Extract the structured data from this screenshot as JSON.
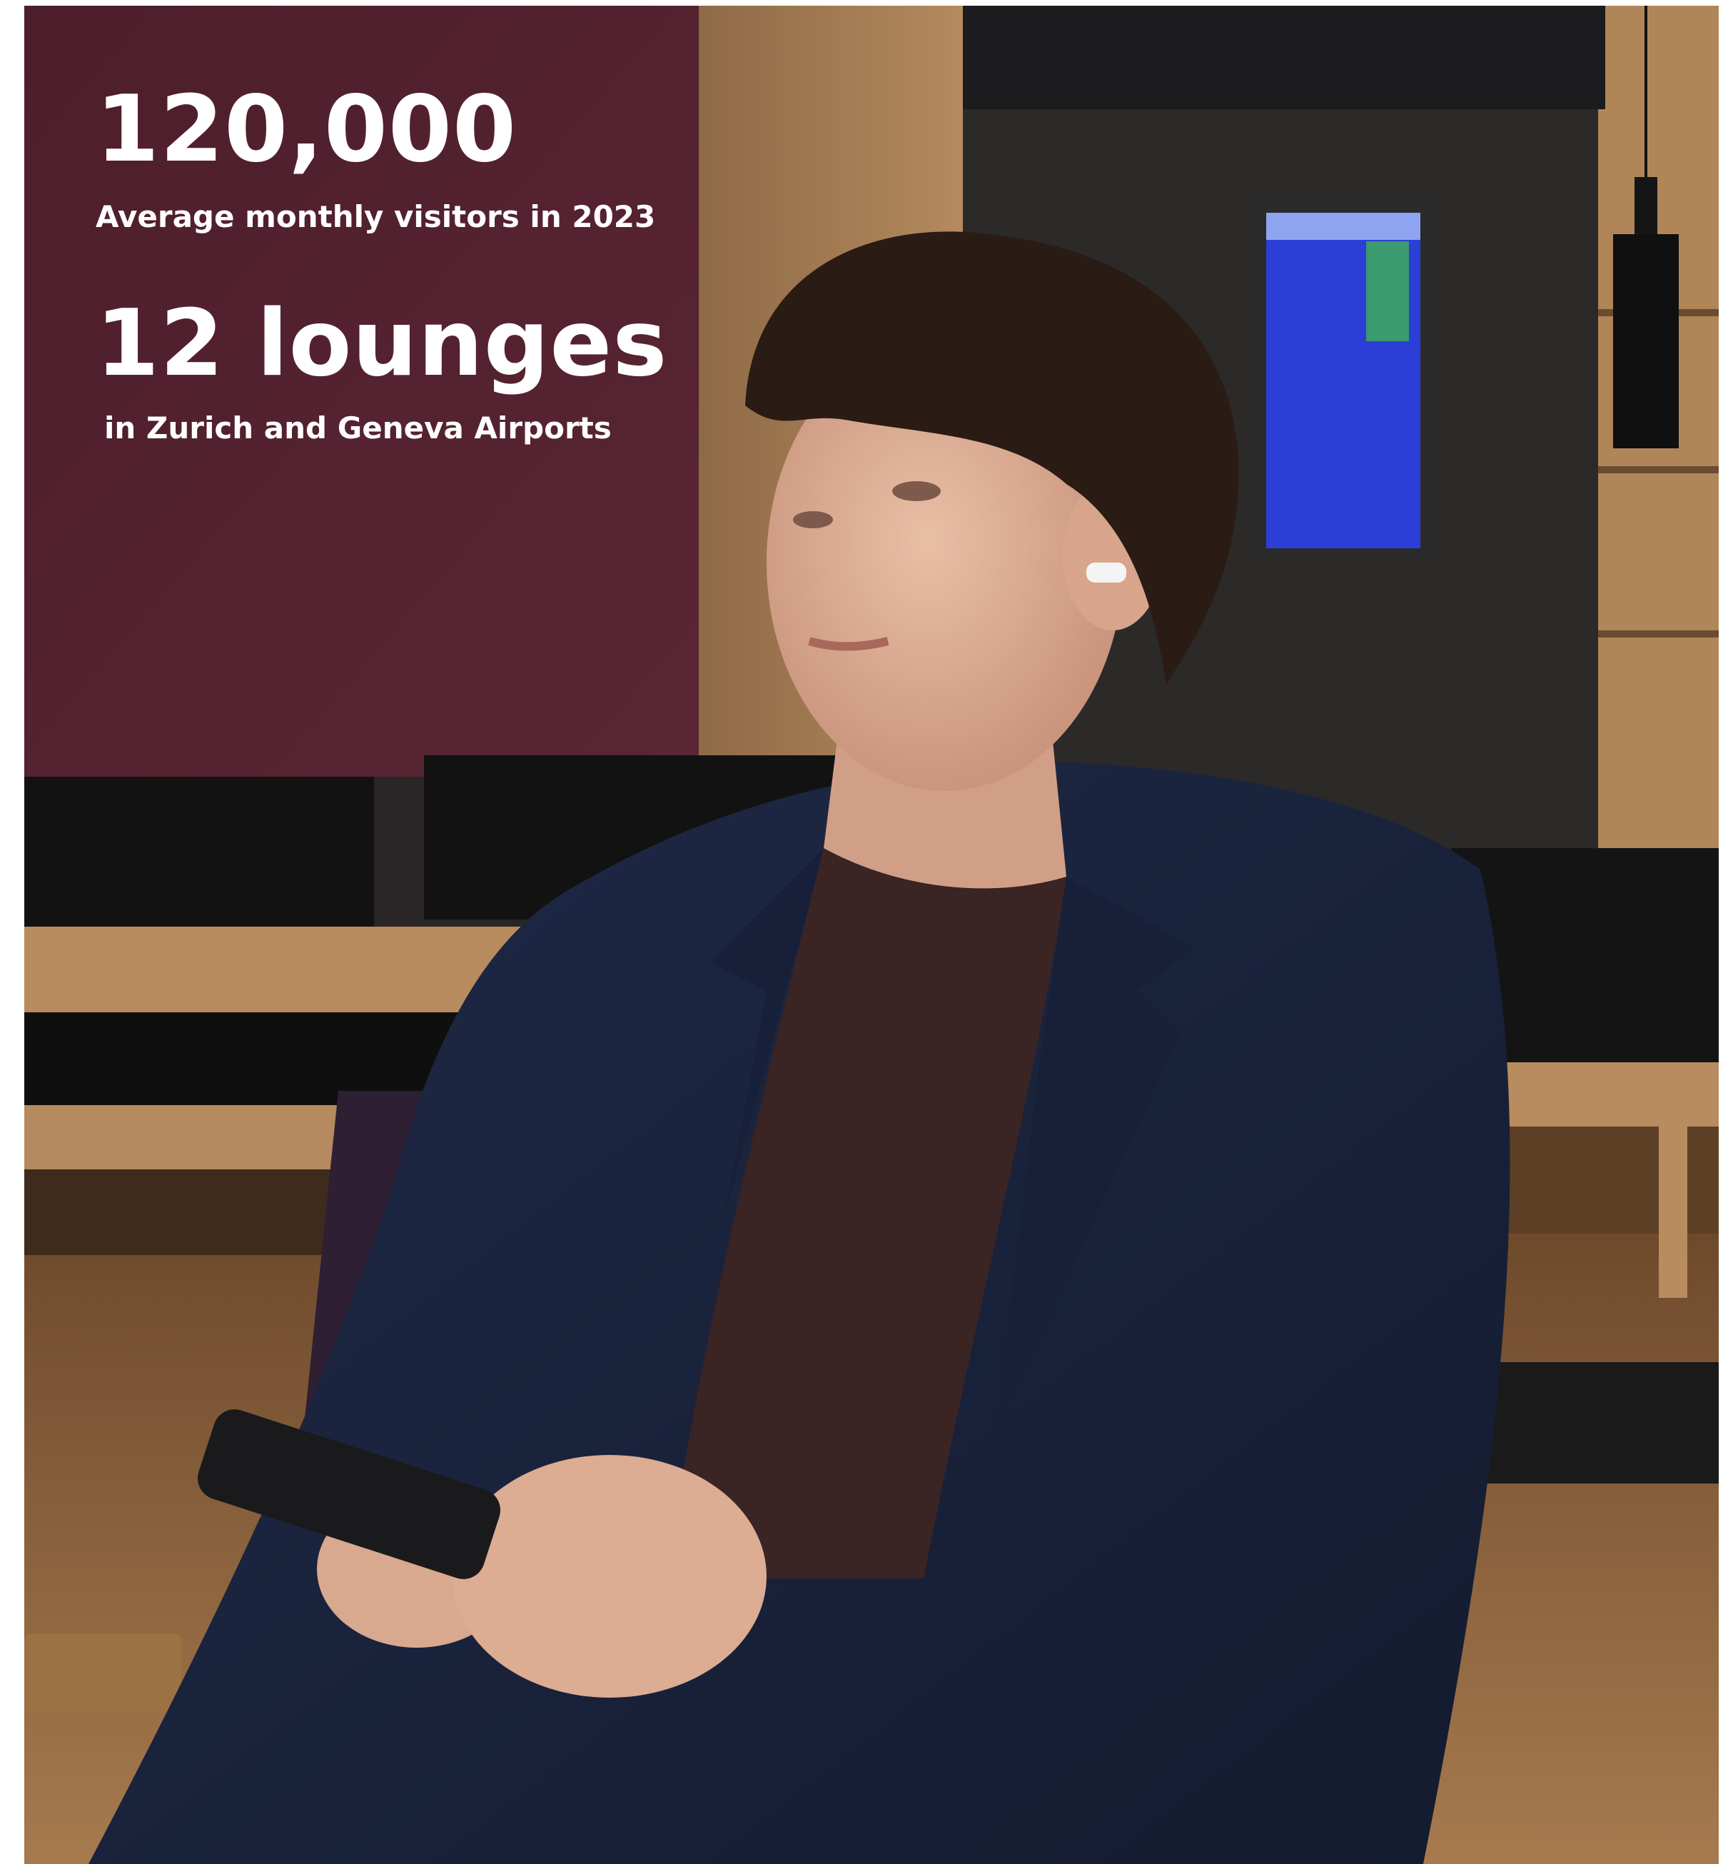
{
  "stats": [
    {
      "value": "120,000",
      "label": "Average monthly visitors in 2023"
    },
    {
      "value": "12 lounges",
      "label": "in Zurich and Geneva Airports"
    }
  ],
  "colors": {
    "wall_maroon": "#4a1f2c",
    "wood": "#b48a5e",
    "jacket_navy": "#1c2540",
    "shirt_brown": "#3b2424",
    "text": "#ffffff"
  }
}
